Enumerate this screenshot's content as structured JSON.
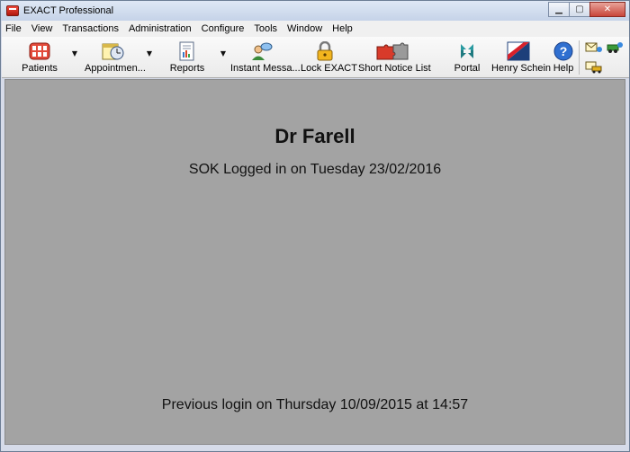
{
  "window": {
    "title": "EXACT Professional",
    "controls": {
      "minimize": "▁",
      "maximize": "▢",
      "close": "✕"
    }
  },
  "menu": [
    "File",
    "View",
    "Transactions",
    "Administration",
    "Configure",
    "Tools",
    "Window",
    "Help"
  ],
  "toolbar": {
    "patients": "Patients",
    "appointments": "Appointmen...",
    "reports": "Reports",
    "instant_messages": "Instant Messa...",
    "lock_exact": "Lock EXACT",
    "short_notice_list": "Short Notice List",
    "portal": "Portal",
    "henry_schein": "Henry Schein",
    "help": "Help",
    "dropdown_glyph": "▼",
    "help_glyph": "?"
  },
  "main": {
    "doctor_name": "Dr  Farell",
    "logged_in": "SOK  Logged in on Tuesday 23/02/2016",
    "previous_login": "Previous login on Thursday 10/09/2015 at 14:57"
  },
  "colors": {
    "workspace": "#a3a3a3",
    "titlebar": "#c5d3e8",
    "close_button": "#c8453a"
  }
}
